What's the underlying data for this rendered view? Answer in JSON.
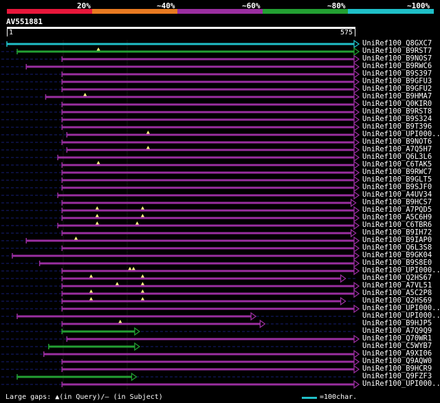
{
  "legend": {
    "labels": [
      "20%",
      "~40%",
      "~60%",
      "~80%",
      "~100%"
    ],
    "colors": [
      "#e8173b",
      "#e87a21",
      "#9a2ea0",
      "#23a033",
      "#1fbfc8"
    ]
  },
  "query": {
    "id": "AV551881",
    "length": 575,
    "ruler_start": "1",
    "ruler_end": "575"
  },
  "hits": [
    {
      "label": "UniRef100_Q8GXC7",
      "color": "#20c0c8",
      "start": 1,
      "end": 575,
      "arrow": true,
      "query_gaps": [],
      "subject_gaps": []
    },
    {
      "label": "UniRef100_B9RST7",
      "color": "#23a033",
      "start": 18,
      "end": 575,
      "arrow": true,
      "query_gaps": [
        152
      ],
      "subject_gaps": []
    },
    {
      "label": "UniRef100_B9NOS7",
      "color": "#9a2ea0",
      "start": 92,
      "end": 575,
      "arrow": true,
      "query_gaps": [],
      "subject_gaps": []
    },
    {
      "label": "UniRef100_B9RWC6",
      "color": "#9a2ea0",
      "start": 33,
      "end": 575,
      "arrow": true,
      "query_gaps": [],
      "subject_gaps": []
    },
    {
      "label": "UniRef100_B9S397",
      "color": "#9a2ea0",
      "start": 92,
      "end": 575,
      "arrow": true,
      "query_gaps": [],
      "subject_gaps": []
    },
    {
      "label": "UniRef100_B9GFU3",
      "color": "#9a2ea0",
      "start": 92,
      "end": 575,
      "arrow": true,
      "query_gaps": [],
      "subject_gaps": []
    },
    {
      "label": "UniRef100_B9GFU2",
      "color": "#9a2ea0",
      "start": 92,
      "end": 575,
      "arrow": true,
      "query_gaps": [],
      "subject_gaps": []
    },
    {
      "label": "UniRef100_B9HMA7",
      "color": "#9a2ea0",
      "start": 65,
      "end": 575,
      "arrow": true,
      "query_gaps": [
        130
      ],
      "subject_gaps": []
    },
    {
      "label": "UniRef100_Q0KIR0",
      "color": "#9a2ea0",
      "start": 92,
      "end": 575,
      "arrow": true,
      "query_gaps": [],
      "subject_gaps": []
    },
    {
      "label": "UniRef100_B9RST8",
      "color": "#9a2ea0",
      "start": 92,
      "end": 575,
      "arrow": true,
      "query_gaps": [],
      "subject_gaps": []
    },
    {
      "label": "UniRef100_B9S324",
      "color": "#9a2ea0",
      "start": 92,
      "end": 575,
      "arrow": true,
      "query_gaps": [],
      "subject_gaps": []
    },
    {
      "label": "UniRef100_B9T396",
      "color": "#9a2ea0",
      "start": 92,
      "end": 575,
      "arrow": true,
      "query_gaps": [],
      "subject_gaps": []
    },
    {
      "label": "UniRef100_UPI000..",
      "color": "#9a2ea0",
      "start": 100,
      "end": 575,
      "arrow": true,
      "query_gaps": [
        234
      ],
      "subject_gaps": []
    },
    {
      "label": "UniRef100_B9NOT6",
      "color": "#9a2ea0",
      "start": 92,
      "end": 575,
      "arrow": true,
      "query_gaps": [],
      "subject_gaps": []
    },
    {
      "label": "UniRef100_A7Q5H7",
      "color": "#9a2ea0",
      "start": 100,
      "end": 575,
      "arrow": true,
      "query_gaps": [
        234
      ],
      "subject_gaps": []
    },
    {
      "label": "UniRef100_Q6L3L6",
      "color": "#9a2ea0",
      "start": 85,
      "end": 575,
      "arrow": true,
      "query_gaps": [],
      "subject_gaps": []
    },
    {
      "label": "UniRef100_C6TAK5",
      "color": "#9a2ea0",
      "start": 92,
      "end": 575,
      "arrow": true,
      "query_gaps": [
        152
      ],
      "subject_gaps": []
    },
    {
      "label": "UniRef100_B9RWC7",
      "color": "#9a2ea0",
      "start": 92,
      "end": 575,
      "arrow": true,
      "query_gaps": [],
      "subject_gaps": []
    },
    {
      "label": "UniRef100_B9GLT5",
      "color": "#9a2ea0",
      "start": 92,
      "end": 575,
      "arrow": true,
      "query_gaps": [],
      "subject_gaps": []
    },
    {
      "label": "UniRef100_B9SJF0",
      "color": "#9a2ea0",
      "start": 92,
      "end": 575,
      "arrow": true,
      "query_gaps": [],
      "subject_gaps": []
    },
    {
      "label": "UniRef100_A4UV34",
      "color": "#9a2ea0",
      "start": 85,
      "end": 575,
      "arrow": true,
      "query_gaps": [],
      "subject_gaps": []
    },
    {
      "label": "UniRef100_B9HCS7",
      "color": "#9a2ea0",
      "start": 92,
      "end": 570,
      "arrow": true,
      "query_gaps": [],
      "subject_gaps": []
    },
    {
      "label": "UniRef100_A7PQD5",
      "color": "#9a2ea0",
      "start": 92,
      "end": 575,
      "arrow": true,
      "query_gaps": [
        150,
        225
      ],
      "subject_gaps": []
    },
    {
      "label": "UniRef100_A5C6H9",
      "color": "#9a2ea0",
      "start": 92,
      "end": 575,
      "arrow": true,
      "query_gaps": [
        150,
        225
      ],
      "subject_gaps": []
    },
    {
      "label": "UniRef100_C6TBR6",
      "color": "#9a2ea0",
      "start": 85,
      "end": 575,
      "arrow": true,
      "query_gaps": [
        150,
        216
      ],
      "subject_gaps": []
    },
    {
      "label": "UniRef100_B9IH72",
      "color": "#9a2ea0",
      "start": 92,
      "end": 570,
      "arrow": true,
      "query_gaps": [],
      "subject_gaps": []
    },
    {
      "label": "UniRef100_B9IAP0",
      "color": "#9a2ea0",
      "start": 33,
      "end": 575,
      "arrow": true,
      "query_gaps": [
        115
      ],
      "subject_gaps": []
    },
    {
      "label": "UniRef100_Q6L3S8",
      "color": "#9a2ea0",
      "start": 92,
      "end": 575,
      "arrow": true,
      "query_gaps": [],
      "subject_gaps": []
    },
    {
      "label": "UniRef100_B9GK04",
      "color": "#9a2ea0",
      "start": 10,
      "end": 575,
      "arrow": true,
      "query_gaps": [],
      "subject_gaps": []
    },
    {
      "label": "UniRef100_B9S8E0",
      "color": "#9a2ea0",
      "start": 55,
      "end": 575,
      "arrow": true,
      "query_gaps": [],
      "subject_gaps": []
    },
    {
      "label": "UniRef100_UPI000..",
      "color": "#9a2ea0",
      "start": 92,
      "end": 575,
      "arrow": true,
      "query_gaps": [
        204,
        210
      ],
      "subject_gaps": []
    },
    {
      "label": "UniRef100_Q2HS67",
      "color": "#9a2ea0",
      "start": 92,
      "end": 553,
      "arrow": true,
      "query_gaps": [
        140,
        225
      ],
      "subject_gaps": []
    },
    {
      "label": "UniRef100_A7VL51",
      "color": "#9a2ea0",
      "start": 92,
      "end": 575,
      "arrow": true,
      "query_gaps": [
        183,
        225
      ],
      "subject_gaps": []
    },
    {
      "label": "UniRef100_A5C2P8",
      "color": "#9a2ea0",
      "start": 92,
      "end": 575,
      "arrow": true,
      "query_gaps": [
        140,
        225
      ],
      "subject_gaps": []
    },
    {
      "label": "UniRef100_Q2HS69",
      "color": "#9a2ea0",
      "start": 92,
      "end": 553,
      "arrow": true,
      "query_gaps": [
        140,
        225
      ],
      "subject_gaps": []
    },
    {
      "label": "UniRef100_UPI000..",
      "color": "#9a2ea0",
      "start": 92,
      "end": 575,
      "arrow": true,
      "query_gaps": [],
      "subject_gaps": []
    },
    {
      "label": "UniRef100_UPI000..",
      "color": "#9a2ea0",
      "start": 18,
      "end": 405,
      "arrow": true,
      "query_gaps": [],
      "subject_gaps": []
    },
    {
      "label": "UniRef100_B9HJP5",
      "color": "#9a2ea0",
      "start": 92,
      "end": 420,
      "arrow": true,
      "query_gaps": [
        188
      ],
      "subject_gaps": []
    },
    {
      "label": "UniRef100_A7Q9Q9",
      "color": "#23a033",
      "start": 92,
      "end": 213,
      "arrow": true,
      "query_gaps": [],
      "subject_gaps": []
    },
    {
      "label": "UniRef100_Q70WR1",
      "color": "#9a2ea0",
      "start": 100,
      "end": 575,
      "arrow": true,
      "query_gaps": [],
      "subject_gaps": []
    },
    {
      "label": "UniRef100_C5WYB7",
      "color": "#23a033",
      "start": 70,
      "end": 213,
      "arrow": true,
      "query_gaps": [],
      "subject_gaps": []
    },
    {
      "label": "UniRef100_A9XI06",
      "color": "#9a2ea0",
      "start": 62,
      "end": 575,
      "arrow": true,
      "query_gaps": [],
      "subject_gaps": []
    },
    {
      "label": "UniRef100_Q9AQW0",
      "color": "#9a2ea0",
      "start": 92,
      "end": 575,
      "arrow": true,
      "query_gaps": [],
      "subject_gaps": []
    },
    {
      "label": "UniRef100_B9HCR9",
      "color": "#9a2ea0",
      "start": 92,
      "end": 575,
      "arrow": true,
      "query_gaps": [],
      "subject_gaps": []
    },
    {
      "label": "UniRef100_Q9FZF3",
      "color": "#23a033",
      "start": 18,
      "end": 208,
      "arrow": true,
      "query_gaps": [],
      "subject_gaps": []
    },
    {
      "label": "UniRef100_UPI000..",
      "color": "#9a2ea0",
      "start": 92,
      "end": 575,
      "arrow": true,
      "query_gaps": [],
      "subject_gaps": []
    }
  ],
  "footer": {
    "gaps_label": "Large gaps:",
    "query_gap_text": "(in Query)/– (in Subject)",
    "scale_text": "=100char."
  }
}
